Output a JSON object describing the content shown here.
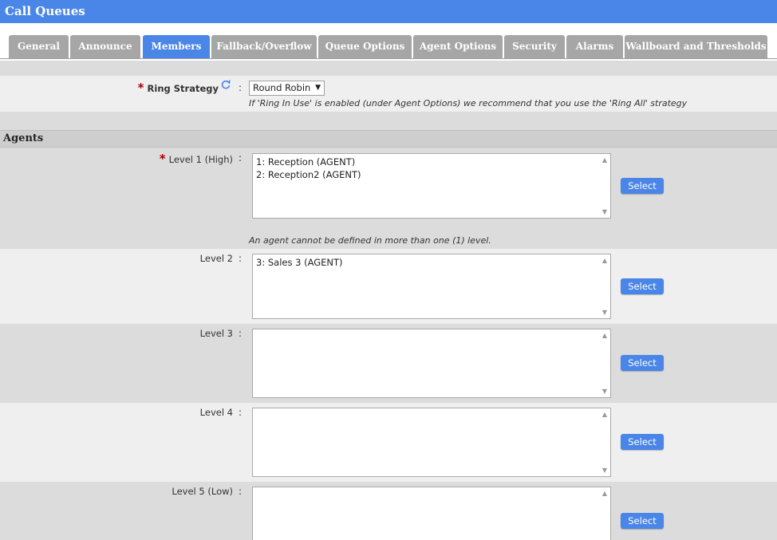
{
  "window": {
    "title": "Call Queues"
  },
  "tabs": [
    {
      "label": "General",
      "active": false
    },
    {
      "label": "Announce",
      "active": false
    },
    {
      "label": "Members",
      "active": true
    },
    {
      "label": "Fallback/Overflow",
      "active": false
    },
    {
      "label": "Queue Options",
      "active": false
    },
    {
      "label": "Agent Options",
      "active": false
    },
    {
      "label": "Security",
      "active": false
    },
    {
      "label": "Alarms",
      "active": false
    },
    {
      "label": "Wallboard and Thresholds",
      "active": false
    }
  ],
  "ring_strategy": {
    "label": "Ring Strategy",
    "required_marker": "*",
    "colon": ":",
    "selected": "Round Robin",
    "hint": "If 'Ring In Use' is enabled (under Agent Options) we recommend that you use the 'Ring All' strategy",
    "refresh_icon": "refresh-icon"
  },
  "agents": {
    "section_title": "Agents",
    "level_hint": "An agent cannot be defined in more than one (1) level.",
    "select_label": "Select",
    "levels": [
      {
        "label": "Level 1 (High)",
        "required": true,
        "items": [
          "1: Reception (AGENT)",
          "2: Reception2 (AGENT)"
        ]
      },
      {
        "label": "Level 2",
        "required": false,
        "items": [
          "3: Sales 3 (AGENT)"
        ]
      },
      {
        "label": "Level 3",
        "required": false,
        "items": []
      },
      {
        "label": "Level 4",
        "required": false,
        "items": []
      },
      {
        "label": "Level 5 (Low)",
        "required": false,
        "items": []
      }
    ]
  },
  "colors": {
    "accent": "#4a86e8",
    "tab_inactive": "#a6a6a6",
    "required": "#a30000"
  }
}
